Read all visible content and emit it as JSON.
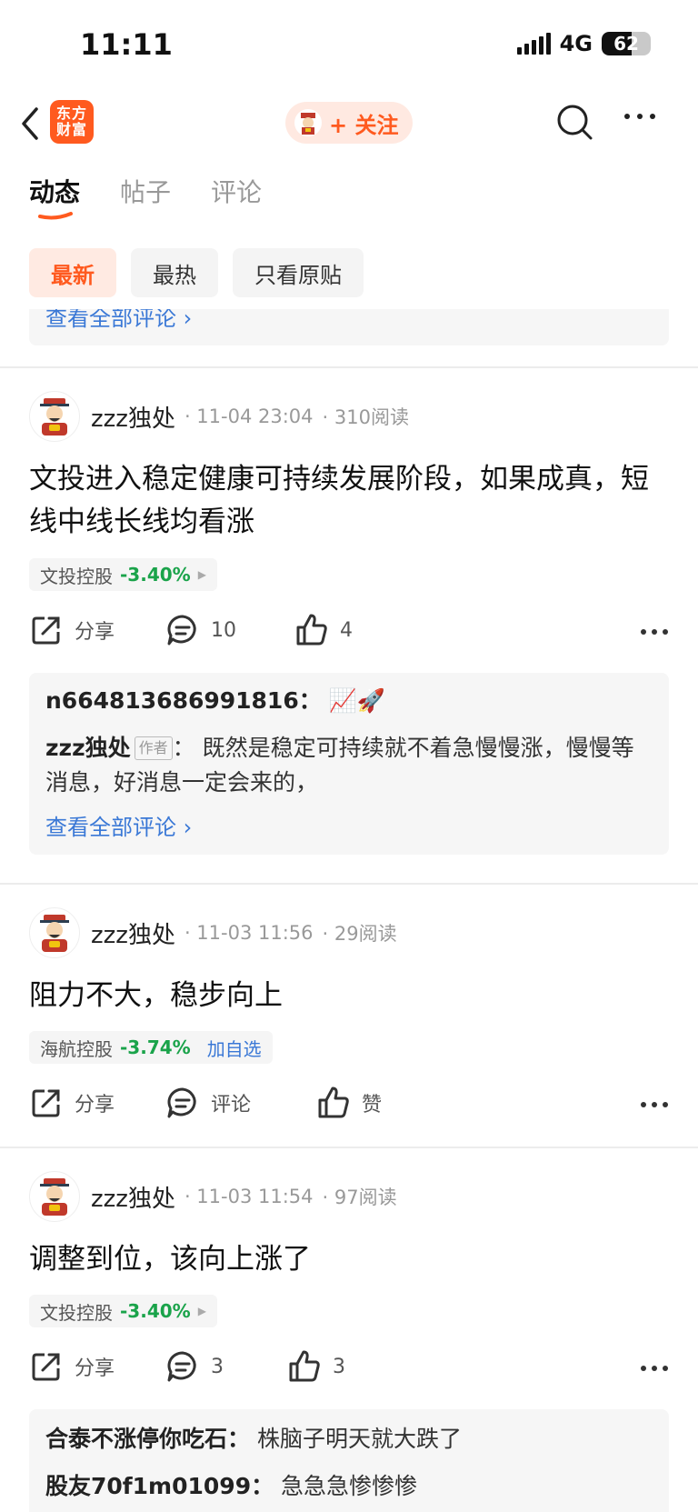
{
  "status": {
    "time": "11:11",
    "network": "4G",
    "battery": "62",
    "battery_level": 0.62
  },
  "nav": {
    "logo_text_line1": "东方",
    "logo_text_line2": "财富",
    "follow_label": "+ 关注"
  },
  "tabs": [
    {
      "label": "动态",
      "active": true
    },
    {
      "label": "帖子",
      "active": false
    },
    {
      "label": "评论",
      "active": false
    }
  ],
  "filters": [
    {
      "label": "最新",
      "active": true
    },
    {
      "label": "最热",
      "active": false
    },
    {
      "label": "只看原贴",
      "active": false
    }
  ],
  "prev_card": {
    "view_all": "查看全部评论 ›"
  },
  "posts": [
    {
      "author": "zzz独处",
      "time": "· 11-04 23:04",
      "reads": "· 310阅读",
      "body": "文投进入稳定健康可持续发展阶段，如果成真，短线中线长线均看涨",
      "stock": {
        "name": "文投控股",
        "change": "-3.40%",
        "extra": "▶"
      },
      "actions": {
        "share": "分享",
        "comment": "10",
        "like": "4"
      },
      "comments": [
        {
          "user": "n664813686991816：",
          "text": "📈🚀"
        },
        {
          "user": "zzz独处",
          "badge": "作者",
          "text": "： 既然是稳定可持续就不着急慢慢涨，慢慢等消息，好消息一定会来的，"
        }
      ],
      "view_all": "查看全部评论 ›"
    },
    {
      "author": "zzz独处",
      "time": "· 11-03 11:56",
      "reads": "· 29阅读",
      "body": "阻力不大，稳步向上",
      "stock": {
        "name": "海航控股",
        "change": "-3.74%",
        "extra": "加自选"
      },
      "actions": {
        "share": "分享",
        "comment": "评论",
        "like": "赞"
      }
    },
    {
      "author": "zzz独处",
      "time": "· 11-03 11:54",
      "reads": "· 97阅读",
      "body": "调整到位，该向上涨了",
      "stock": {
        "name": "文投控股",
        "change": "-3.40%",
        "extra": "▶"
      },
      "actions": {
        "share": "分享",
        "comment": "3",
        "like": "3"
      },
      "comments": [
        {
          "user": "合泰不涨停你吃石：",
          "text": " 株脑子明天就大跌了"
        },
        {
          "user": "股友70f1m01099：",
          "text": " 急急急惨惨惨"
        }
      ]
    }
  ],
  "colors": {
    "accent": "#ff5a1f",
    "link": "#3a78d6",
    "down": "#1aa34a"
  }
}
